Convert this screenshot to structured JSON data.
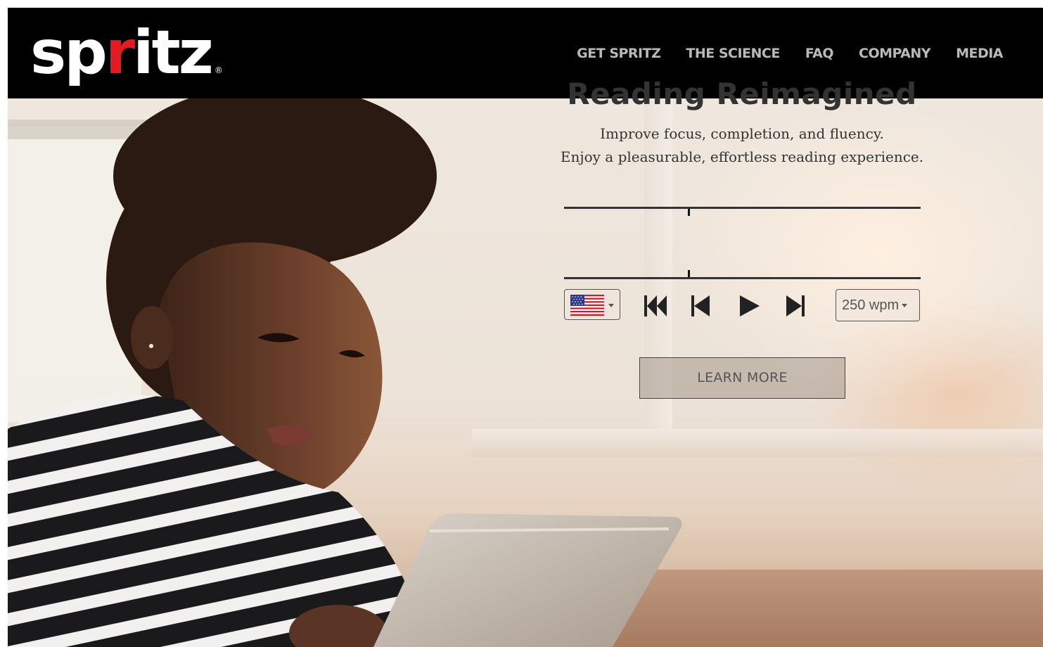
{
  "header": {
    "logo": {
      "part1": "sp",
      "part2": "r",
      "part3": "itz",
      "reg": "®"
    },
    "nav": [
      {
        "label": "GET SPRITZ"
      },
      {
        "label": "THE SCIENCE"
      },
      {
        "label": "FAQ"
      },
      {
        "label": "COMPANY"
      },
      {
        "label": "MEDIA"
      }
    ]
  },
  "hero": {
    "title": "Reading Reimagined",
    "subtitle_line1": "Improve focus, completion, and fluency.",
    "subtitle_line2": "Enjoy a pleasurable, effortless reading experience.",
    "player": {
      "language_icon": "us-flag-icon",
      "controls": [
        "skip-to-start-icon",
        "previous-icon",
        "play-icon",
        "next-icon"
      ],
      "speed": "250 wpm"
    },
    "cta": "LEARN MORE"
  },
  "colors": {
    "header_bg": "#000000",
    "logo_accent": "#e21b23",
    "nav_text": "#b9b9b9",
    "title_text": "#333333"
  }
}
